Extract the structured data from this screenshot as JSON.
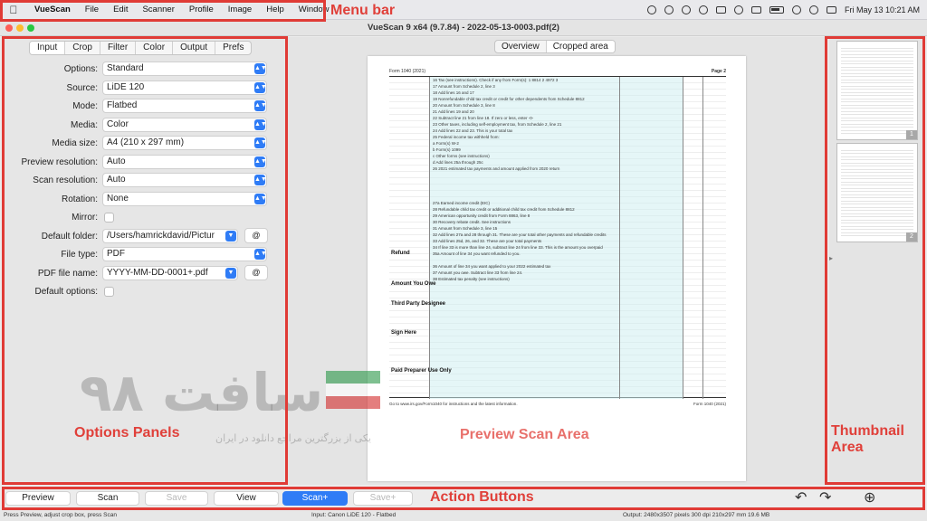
{
  "menubar": {
    "app": "VueScan",
    "items": [
      "File",
      "Edit",
      "Scanner",
      "Profile",
      "Image",
      "Help",
      "Window"
    ],
    "clock": "Fri May 13  10:21 AM"
  },
  "window": {
    "title": "VueScan 9 x64 (9.7.84) - 2022-05-13-0003.pdf(2)"
  },
  "options": {
    "tabs": [
      "Input",
      "Crop",
      "Filter",
      "Color",
      "Output",
      "Prefs"
    ],
    "active_tab": "Input",
    "rows": [
      {
        "label": "Options:",
        "value": "Standard"
      },
      {
        "label": "Source:",
        "value": "LiDE 120"
      },
      {
        "label": "Mode:",
        "value": "Flatbed"
      },
      {
        "label": "Media:",
        "value": "Color"
      },
      {
        "label": "Media size:",
        "value": "A4 (210 x 297 mm)"
      },
      {
        "label": "Preview resolution:",
        "value": "Auto"
      },
      {
        "label": "Scan resolution:",
        "value": "Auto"
      },
      {
        "label": "Rotation:",
        "value": "None"
      },
      {
        "label": "Mirror:"
      },
      {
        "label": "Default folder:",
        "value": "/Users/hamrickdavid/Pictur",
        "button": "@"
      },
      {
        "label": "File type:",
        "value": "PDF"
      },
      {
        "label": "PDF file name:",
        "value": "YYYY-MM-DD-0001+.pdf",
        "button": "@"
      },
      {
        "label": "Default options:"
      }
    ]
  },
  "preview": {
    "tabs": [
      "Overview",
      "Cropped area"
    ],
    "active_tab": "Cropped area",
    "form": {
      "header_left": "Form 1040 (2021)",
      "header_right": "Page 2",
      "lines": [
        "16  Tax (see instructions). Check if any from Form(s): 1 8814  2 4972  3",
        "17  Amount from Schedule 2, line 3",
        "18  Add lines 16 and 17",
        "19  Nonrefundable child tax credit or credit for other dependents from Schedule 8812",
        "20  Amount from Schedule 3, line 8",
        "21  Add lines 19 and 20",
        "22  Subtract line 21 from line 18. If zero or less, enter -0-",
        "23  Other taxes, including self-employment tax, from Schedule 2, line 21",
        "24  Add lines 22 and 23. This is your total tax",
        "25  Federal income tax withheld from:",
        "a  Form(s) W-2",
        "b  Form(s) 1099",
        "c  Other forms (see instructions)",
        "d  Add lines 25a through 25c",
        "26  2021 estimated tax payments and amount applied from 2020 return",
        "27a  Earned income credit (EIC)",
        "28  Refundable child tax credit or additional child tax credit from Schedule 8812",
        "29  American opportunity credit from Form 8863, line 8",
        "30  Recovery rebate credit. See instructions",
        "31  Amount from Schedule 3, line 15",
        "32  Add lines 27a and 28 through 31. These are your total other payments and refundable credits",
        "33  Add lines 25d, 26, and 32. These are your total payments",
        "34  If line 33 is more than line 24, subtract line 24 from line 33. This is the amount you overpaid",
        "35a  Amount of line 34 you want refunded to you.",
        "36  Amount of line 34 you want applied to your 2022 estimated tax",
        "37  Amount you owe. Subtract line 33 from line 24.",
        "38  Estimated tax penalty (see instructions)"
      ],
      "sections": [
        "Refund",
        "Amount You Owe",
        "Third Party Designee",
        "Sign Here",
        "Paid Preparer Use Only"
      ],
      "footer_left": "Go to www.irs.gov/Form1040 for instructions and the latest information.",
      "footer_right": "Form 1040 (2021)"
    },
    "watermark": "سافت ۹۸",
    "watermark_sub": "یکی از بزرگترین مراجع دانلود در ایران"
  },
  "thumbnails": [
    {
      "number": "1"
    },
    {
      "number": "2"
    }
  ],
  "actions": {
    "preview": "Preview",
    "scan": "Scan",
    "save": "Save",
    "view": "View",
    "scan_plus": "Scan+",
    "save_plus": "Save+"
  },
  "status": {
    "left": "Press Preview, adjust crop box, press Scan",
    "middle": "Input: Canon LiDE 120 - Flatbed",
    "right": "Output: 2480x3507 pixels 300 dpi 210x297 mm 19.6 MB"
  },
  "annotations": {
    "menu_bar": "Menu bar",
    "options_panels": "Options Panels",
    "preview_area": "Preview Scan Area",
    "thumbnail_area": "Thumbnail Area",
    "action_buttons": "Action Buttons"
  },
  "colors": {
    "accent": "#2f7cf6",
    "annotation": "#e03b36"
  }
}
